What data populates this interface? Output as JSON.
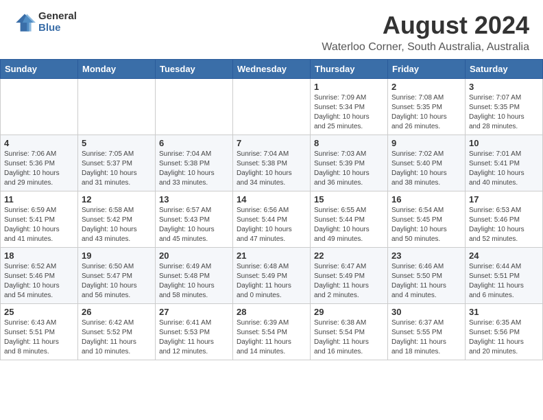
{
  "logo": {
    "general": "General",
    "blue": "Blue"
  },
  "header": {
    "month_year": "August 2024",
    "location": "Waterloo Corner, South Australia, Australia"
  },
  "weekdays": [
    "Sunday",
    "Monday",
    "Tuesday",
    "Wednesday",
    "Thursday",
    "Friday",
    "Saturday"
  ],
  "weeks": [
    [
      {
        "day": "",
        "info": ""
      },
      {
        "day": "",
        "info": ""
      },
      {
        "day": "",
        "info": ""
      },
      {
        "day": "",
        "info": ""
      },
      {
        "day": "1",
        "info": "Sunrise: 7:09 AM\nSunset: 5:34 PM\nDaylight: 10 hours\nand 25 minutes."
      },
      {
        "day": "2",
        "info": "Sunrise: 7:08 AM\nSunset: 5:35 PM\nDaylight: 10 hours\nand 26 minutes."
      },
      {
        "day": "3",
        "info": "Sunrise: 7:07 AM\nSunset: 5:35 PM\nDaylight: 10 hours\nand 28 minutes."
      }
    ],
    [
      {
        "day": "4",
        "info": "Sunrise: 7:06 AM\nSunset: 5:36 PM\nDaylight: 10 hours\nand 29 minutes."
      },
      {
        "day": "5",
        "info": "Sunrise: 7:05 AM\nSunset: 5:37 PM\nDaylight: 10 hours\nand 31 minutes."
      },
      {
        "day": "6",
        "info": "Sunrise: 7:04 AM\nSunset: 5:38 PM\nDaylight: 10 hours\nand 33 minutes."
      },
      {
        "day": "7",
        "info": "Sunrise: 7:04 AM\nSunset: 5:38 PM\nDaylight: 10 hours\nand 34 minutes."
      },
      {
        "day": "8",
        "info": "Sunrise: 7:03 AM\nSunset: 5:39 PM\nDaylight: 10 hours\nand 36 minutes."
      },
      {
        "day": "9",
        "info": "Sunrise: 7:02 AM\nSunset: 5:40 PM\nDaylight: 10 hours\nand 38 minutes."
      },
      {
        "day": "10",
        "info": "Sunrise: 7:01 AM\nSunset: 5:41 PM\nDaylight: 10 hours\nand 40 minutes."
      }
    ],
    [
      {
        "day": "11",
        "info": "Sunrise: 6:59 AM\nSunset: 5:41 PM\nDaylight: 10 hours\nand 41 minutes."
      },
      {
        "day": "12",
        "info": "Sunrise: 6:58 AM\nSunset: 5:42 PM\nDaylight: 10 hours\nand 43 minutes."
      },
      {
        "day": "13",
        "info": "Sunrise: 6:57 AM\nSunset: 5:43 PM\nDaylight: 10 hours\nand 45 minutes."
      },
      {
        "day": "14",
        "info": "Sunrise: 6:56 AM\nSunset: 5:44 PM\nDaylight: 10 hours\nand 47 minutes."
      },
      {
        "day": "15",
        "info": "Sunrise: 6:55 AM\nSunset: 5:44 PM\nDaylight: 10 hours\nand 49 minutes."
      },
      {
        "day": "16",
        "info": "Sunrise: 6:54 AM\nSunset: 5:45 PM\nDaylight: 10 hours\nand 50 minutes."
      },
      {
        "day": "17",
        "info": "Sunrise: 6:53 AM\nSunset: 5:46 PM\nDaylight: 10 hours\nand 52 minutes."
      }
    ],
    [
      {
        "day": "18",
        "info": "Sunrise: 6:52 AM\nSunset: 5:46 PM\nDaylight: 10 hours\nand 54 minutes."
      },
      {
        "day": "19",
        "info": "Sunrise: 6:50 AM\nSunset: 5:47 PM\nDaylight: 10 hours\nand 56 minutes."
      },
      {
        "day": "20",
        "info": "Sunrise: 6:49 AM\nSunset: 5:48 PM\nDaylight: 10 hours\nand 58 minutes."
      },
      {
        "day": "21",
        "info": "Sunrise: 6:48 AM\nSunset: 5:49 PM\nDaylight: 11 hours\nand 0 minutes."
      },
      {
        "day": "22",
        "info": "Sunrise: 6:47 AM\nSunset: 5:49 PM\nDaylight: 11 hours\nand 2 minutes."
      },
      {
        "day": "23",
        "info": "Sunrise: 6:46 AM\nSunset: 5:50 PM\nDaylight: 11 hours\nand 4 minutes."
      },
      {
        "day": "24",
        "info": "Sunrise: 6:44 AM\nSunset: 5:51 PM\nDaylight: 11 hours\nand 6 minutes."
      }
    ],
    [
      {
        "day": "25",
        "info": "Sunrise: 6:43 AM\nSunset: 5:51 PM\nDaylight: 11 hours\nand 8 minutes."
      },
      {
        "day": "26",
        "info": "Sunrise: 6:42 AM\nSunset: 5:52 PM\nDaylight: 11 hours\nand 10 minutes."
      },
      {
        "day": "27",
        "info": "Sunrise: 6:41 AM\nSunset: 5:53 PM\nDaylight: 11 hours\nand 12 minutes."
      },
      {
        "day": "28",
        "info": "Sunrise: 6:39 AM\nSunset: 5:54 PM\nDaylight: 11 hours\nand 14 minutes."
      },
      {
        "day": "29",
        "info": "Sunrise: 6:38 AM\nSunset: 5:54 PM\nDaylight: 11 hours\nand 16 minutes."
      },
      {
        "day": "30",
        "info": "Sunrise: 6:37 AM\nSunset: 5:55 PM\nDaylight: 11 hours\nand 18 minutes."
      },
      {
        "day": "31",
        "info": "Sunrise: 6:35 AM\nSunset: 5:56 PM\nDaylight: 11 hours\nand 20 minutes."
      }
    ]
  ]
}
